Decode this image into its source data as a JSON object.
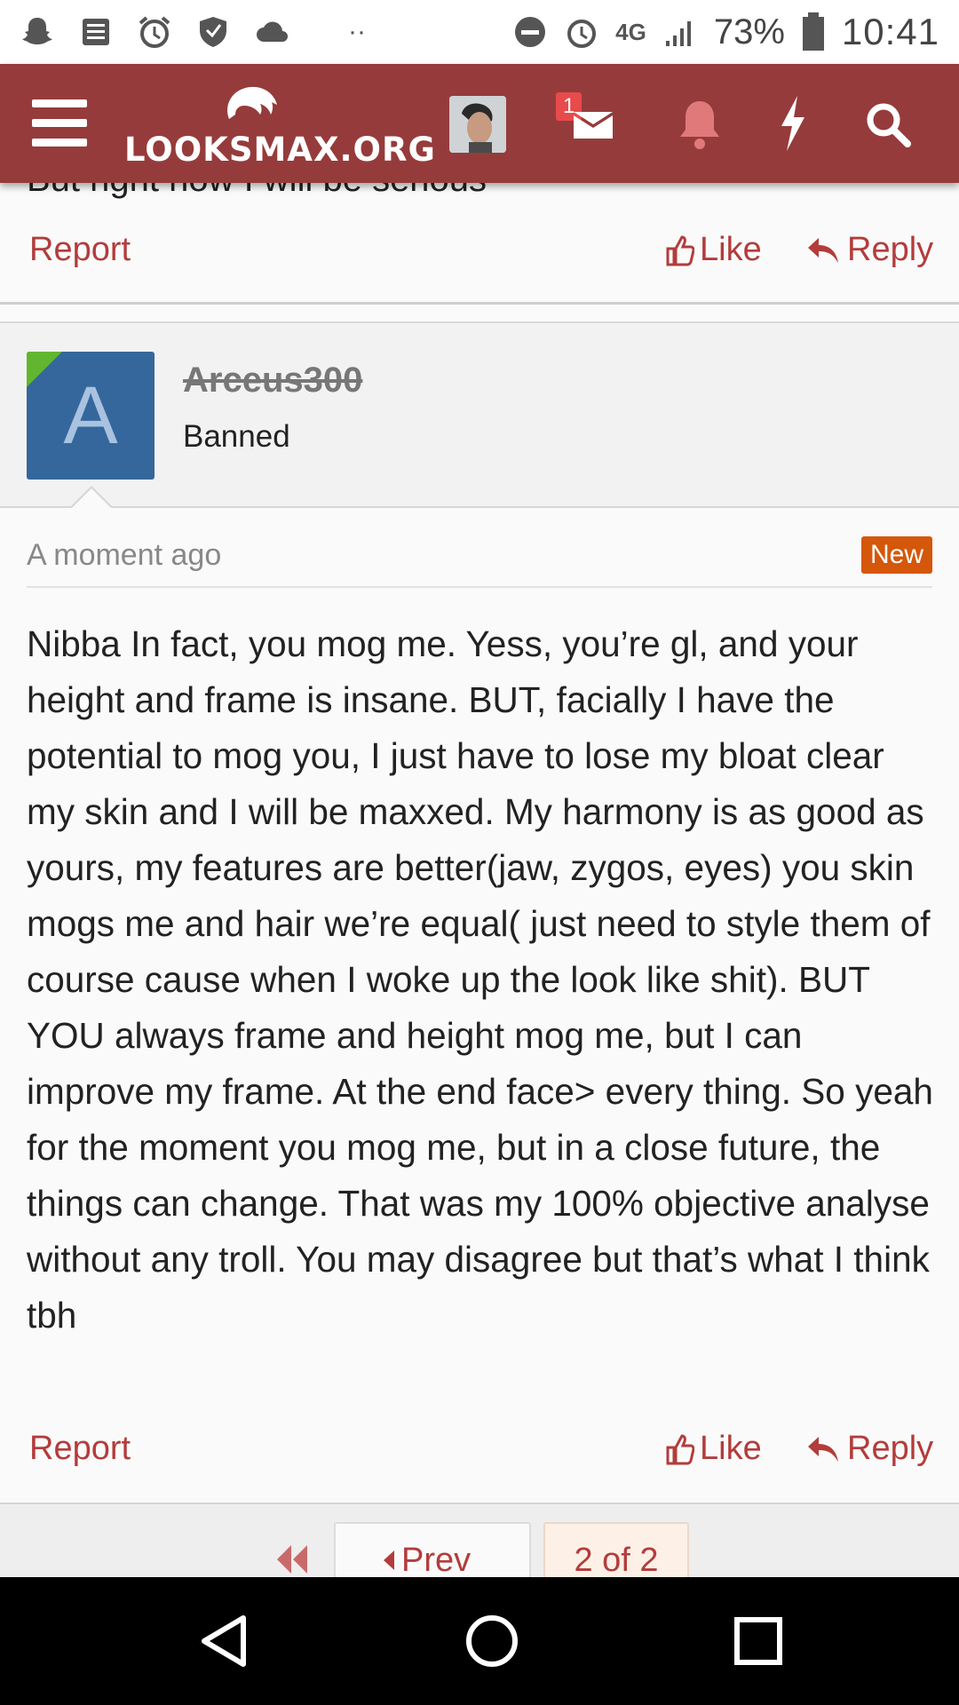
{
  "status_bar": {
    "network": "4G",
    "battery": "73%",
    "time": "10:41"
  },
  "header": {
    "logo_text": "LOOKSMAX.ORG",
    "inbox_badge": "1"
  },
  "previous_post": {
    "partial_text": "But right now I will be serious",
    "report_label": "Report",
    "like_label": "Like",
    "reply_label": "Reply"
  },
  "post": {
    "avatar_letter": "A",
    "username": "Arceus300",
    "user_title": "Banned",
    "timestamp": "A moment ago",
    "new_badge": "New",
    "message": "Nibba In fact, you mog me. Yess, you’re gl, and your height and frame is insane. BUT, facially I have the potential to mog you, I just have to lose my bloat clear my skin and I will be maxxed. My harmony is as good as yours, my features are better(jaw, zygos, eyes) you skin mogs me and hair we’re equal( just need to style them of course cause when I woke up the look like shit). BUT YOU always frame and height mog me, but I can improve my frame. At the end face> every thing. So yeah for the moment you mog me, but in a close future, the things can change. That was my 100% objective analyse without any troll. You may disagree but that’s what I think tbh",
    "report_label": "Report",
    "like_label": "Like",
    "reply_label": "Reply"
  },
  "pagination": {
    "prev_label": "Prev",
    "current": "2 of 2"
  },
  "colors": {
    "brand": "#963b3b",
    "link": "#b33c3c",
    "new_badge": "#d4570a",
    "avatar_bg": "#35679c",
    "online_corner": "#62b52f"
  },
  "icons": [
    "snapchat-icon",
    "news-icon",
    "alarm-icon",
    "vpn-shield-icon",
    "cloud-icon",
    "dnd-icon",
    "signal-icon",
    "battery-icon",
    "menu-icon",
    "inbox-icon",
    "bell-icon",
    "bolt-icon",
    "search-icon",
    "thumbs-up-icon",
    "reply-arrow-icon",
    "first-page-icon",
    "back-nav-icon",
    "home-nav-icon",
    "recents-nav-icon"
  ]
}
